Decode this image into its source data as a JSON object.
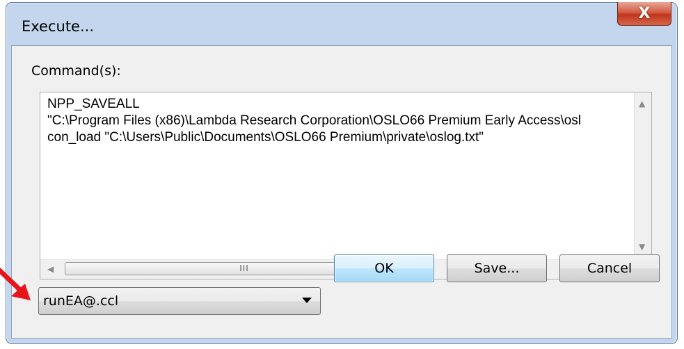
{
  "window": {
    "title": "Execute...",
    "close_symbol": "X"
  },
  "commands": {
    "label": "Command(s):",
    "text": "NPP_SAVEALL\n\"C:\\Program Files (x86)\\Lambda Research Corporation\\OSLO66 Premium Early Access\\osl\ncon_load \"C:\\Users\\Public\\Documents\\OSLO66 Premium\\private\\oslog.txt\"",
    "hscroll_grip": "III"
  },
  "file_combo": {
    "selected": "runEA@.ccl"
  },
  "buttons": {
    "ok": "OK",
    "save": "Save...",
    "cancel": "Cancel"
  },
  "colors": {
    "annotation_arrow": "#e8141c",
    "default_button_border": "#3c7fb1",
    "close_button": "#c1361c"
  },
  "icons": [
    "close-icon",
    "scroll-up-icon",
    "scroll-down-icon",
    "scroll-left-icon",
    "scroll-right-icon",
    "dropdown-arrow-icon",
    "annotation-arrow-icon"
  ]
}
